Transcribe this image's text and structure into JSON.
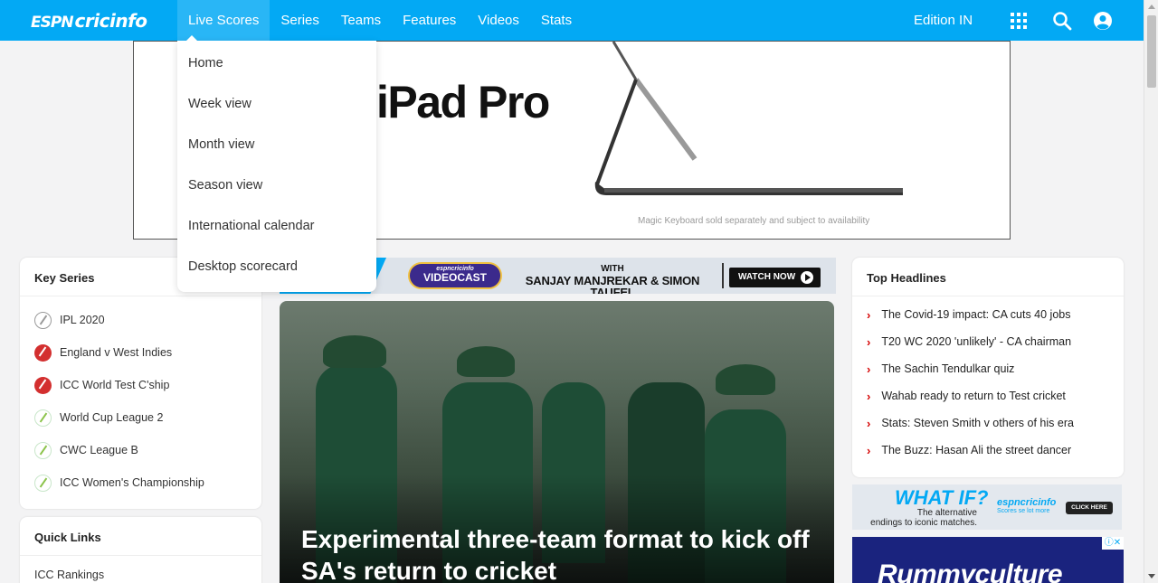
{
  "brand": {
    "logo_espn": "ESPN",
    "logo_name": "cricinfo"
  },
  "nav": {
    "items": [
      "Live Scores",
      "Series",
      "Teams",
      "Features",
      "Videos",
      "Stats"
    ],
    "edition": "Edition IN",
    "accent": "#03a9f4"
  },
  "dropdown": {
    "items": [
      "Home",
      "Week view",
      "Month view",
      "Season view",
      "International calendar",
      "Desktop scorecard"
    ]
  },
  "ad_banner": {
    "headline": "iPad Pro",
    "footnote": "Magic Keyboard sold separately and subject to availability"
  },
  "key_series": {
    "title": "Key Series",
    "items": [
      {
        "label": "IPL 2020",
        "ball": "grey"
      },
      {
        "label": "England v West Indies",
        "ball": "red"
      },
      {
        "label": "ICC World Test C'ship",
        "ball": "red"
      },
      {
        "label": "World Cup League 2",
        "ball": "green"
      },
      {
        "label": "CWC League B",
        "ball": "green"
      },
      {
        "label": "ICC Women's Championship",
        "ball": "green"
      }
    ]
  },
  "quick_links": {
    "title": "Quick Links",
    "items": [
      "ICC Rankings"
    ]
  },
  "videocast": {
    "brand_small": "espncricinfo",
    "brand": "VIDEOCAST",
    "with": "WITH",
    "names": "SANJAY MANJREKAR & SIMON TAUFEL",
    "button": "WATCH NOW"
  },
  "hero": {
    "title": "Experimental three-team format to kick off SA's return to cricket"
  },
  "top_headlines": {
    "title": "Top Headlines",
    "items": [
      "The Covid-19 impact: CA cuts 40 jobs",
      "T20 WC 2020 'unlikely' - CA chairman",
      "The Sachin Tendulkar quiz",
      "Wahab ready to return to Test cricket",
      "Stats: Steven Smith v others of his era",
      "The Buzz: Hasan Ali the street dancer"
    ]
  },
  "whatif_ad": {
    "title": "WHAT IF?",
    "subtitle_1": "The alternative",
    "subtitle_2": "endings to iconic matches.",
    "logo": "espncricinfo",
    "logo_sub": "Scores se lot more",
    "button": "CLICK HERE"
  },
  "rummy_ad": {
    "title": "Rummyculture"
  }
}
